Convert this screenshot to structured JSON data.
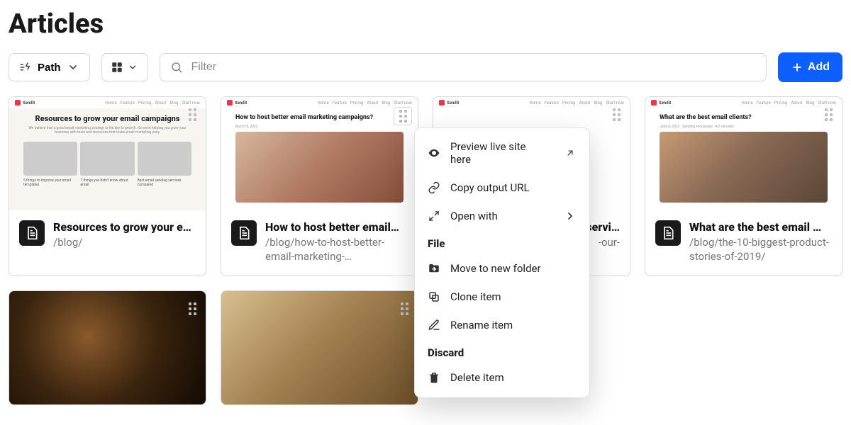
{
  "page": {
    "title": "Articles"
  },
  "toolbar": {
    "sort_label": "Path",
    "filter_placeholder": "Filter",
    "add_label": "Add"
  },
  "cards": [
    {
      "title": "Resources to grow your e…",
      "path": "/blog/",
      "thumb": {
        "layout": "hero3",
        "title": "Resources to grow your email campaigns",
        "sub": "We believe that a good email marketing strategy is the key to growth. So we're helping you grow your business with tools and resources that make email marketing easy.",
        "cells": [
          "5 things to improve your email templates",
          "7 things you didn't know about email",
          "Best email sending services compared"
        ]
      }
    },
    {
      "title": "How to host better email…",
      "path": "/blog/how-to-host-better-email-marketing-…",
      "thumb": {
        "layout": "article",
        "title": "How to host better email marketing campaigns?",
        "meta": "March 8, 2022"
      }
    },
    {
      "title": "servi…",
      "path": "-our-",
      "thumb": {
        "layout": "hidden"
      }
    },
    {
      "title": "What are the best email …",
      "path": "/blog/the-10-biggest-product-stories-of-2019/",
      "thumb": {
        "layout": "article",
        "title": "What are the best email clients?",
        "meta": "June 8, 2022   ·   Sending Processes   ·   4.5 minutes"
      }
    },
    {
      "title": "",
      "path": "",
      "thumb": {
        "layout": "photo-dark"
      }
    },
    {
      "title": "",
      "path": "",
      "thumb": {
        "layout": "photo-class"
      }
    }
  ],
  "thumb_nav": [
    "Home",
    "Feature",
    "Pricing",
    "About",
    "Blog",
    "Start now"
  ],
  "thumb_brand": "Sendit",
  "context_menu": {
    "preview": "Preview live site here",
    "copy_url": "Copy output URL",
    "open_with": "Open with",
    "section_file": "File",
    "move": "Move to new folder",
    "clone": "Clone item",
    "rename": "Rename item",
    "section_discard": "Discard",
    "delete": "Delete item"
  }
}
